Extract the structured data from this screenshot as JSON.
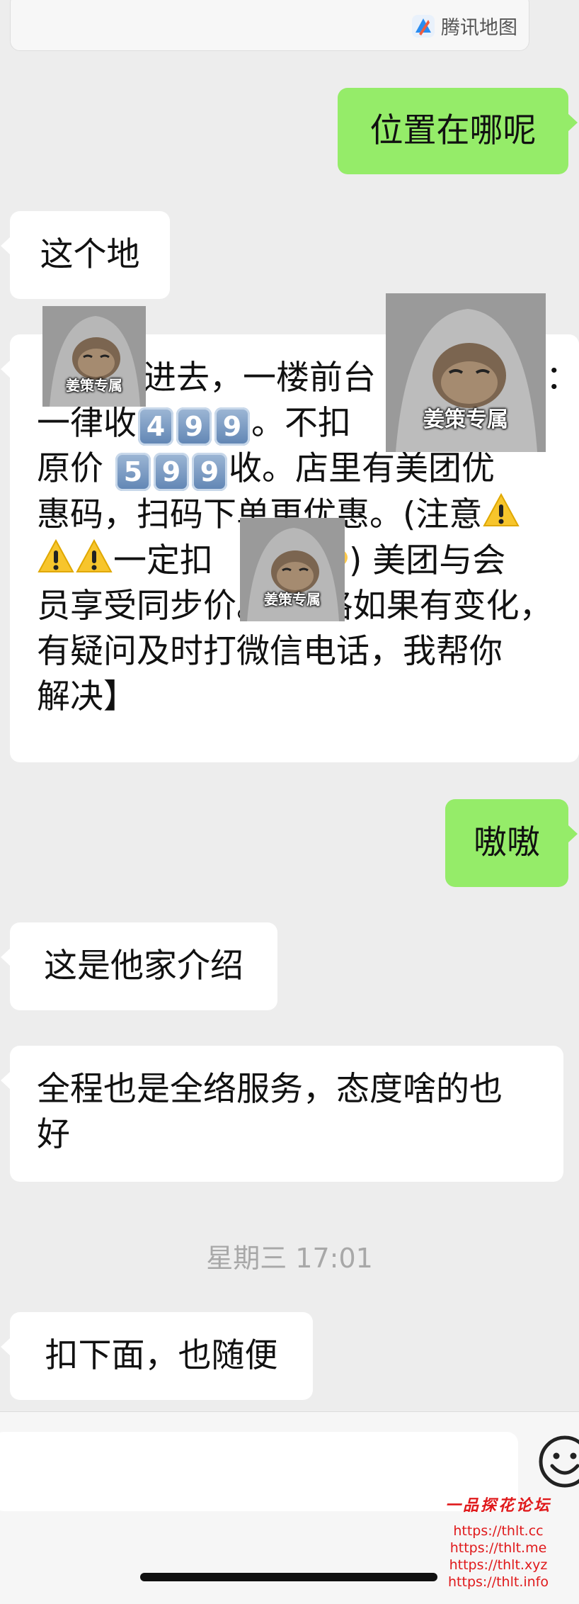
{
  "location_card": {
    "brand": "腾讯地图",
    "icon": "tencent-map-icon"
  },
  "msg_location_q": {
    "text": "位置在哪呢"
  },
  "msg_this_place": {
    "text": "这个地"
  },
  "long_msg": {
    "l1a": "进去，一楼前台",
    "l1b": "：",
    "l2a": "一律收",
    "l2b": "。不扣",
    "l3a": "原价",
    "l3b": "收。店里有美团优",
    "l4a": "惠码，扫码下",
    "l4b": "单更优惠。(注意",
    "l5b": "一定扣",
    "l5c": ") 美团与会",
    "l6": "员享受同步价。【价格如果有变化，",
    "l7": "有疑问及时打微信电话，我帮你",
    "l8": "解决】",
    "keycaps_a": [
      "4",
      "9",
      "9"
    ],
    "keycaps_b": [
      "5",
      "9",
      "9"
    ]
  },
  "sticker": {
    "caption": "姜策专属"
  },
  "msg_ok": {
    "text": "嗷嗷"
  },
  "msg_intro": {
    "text": "这是他家介绍"
  },
  "msg_service": {
    "line1": "全程也是全络服务，态度啥的也",
    "line2": "好"
  },
  "timestamp": {
    "text": "星期三 17:01"
  },
  "msg_last": {
    "text": "扣下面，也随便"
  },
  "input_bar": {
    "emoji_icon": "emoji-face-icon"
  },
  "watermark": {
    "title": "一品探花论坛",
    "urls": [
      "https://thlt.cc",
      "https://thlt.me",
      "https://thlt.xyz",
      "https://thlt.info"
    ]
  },
  "colors": {
    "background": "#ededed",
    "incoming_bubble": "#ffffff",
    "outgoing_bubble": "#95ec69",
    "watermark": "#e0191b"
  }
}
